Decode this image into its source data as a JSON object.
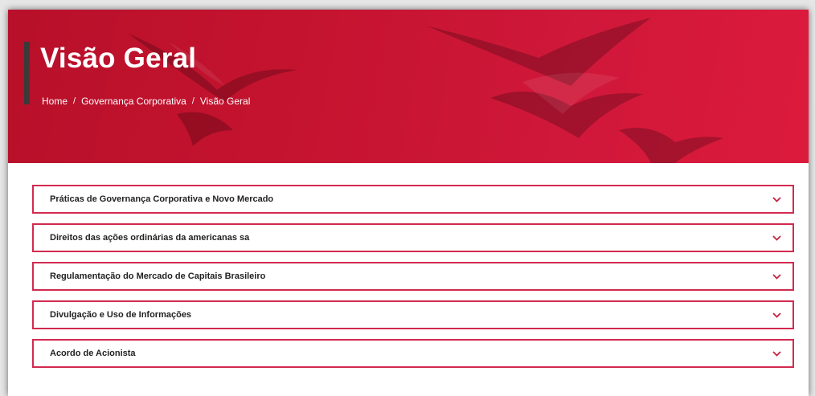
{
  "hero": {
    "title": "Visão Geral",
    "breadcrumb": [
      {
        "label": "Home"
      },
      {
        "label": "Governança Corporativa"
      },
      {
        "label": "Visão Geral"
      }
    ],
    "separator": "/"
  },
  "accordion": {
    "items": [
      {
        "label": "Práticas de Governança Corporativa e Novo Mercado",
        "icon": "chevron-down-icon"
      },
      {
        "label": "Direitos das ações ordinárias da americanas sa",
        "icon": "chevron-down-icon"
      },
      {
        "label": "Regulamentação do Mercado de Capitais Brasileiro",
        "icon": "chevron-down-icon"
      },
      {
        "label": "Divulgação e Uso de Informações",
        "icon": "chevron-down-icon"
      },
      {
        "label": "Acordo de Acionista",
        "icon": "chevron-down-icon"
      }
    ]
  },
  "colors": {
    "brand_red": "#d0183a",
    "border_pink": "#d22a4f",
    "chevron": "#c8203f"
  }
}
